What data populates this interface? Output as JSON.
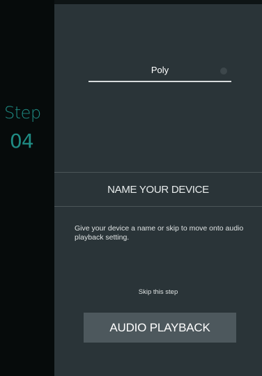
{
  "step": {
    "word": "Step",
    "number": "04"
  },
  "device_name": {
    "value": "Poly"
  },
  "section": {
    "title": "NAME YOUR DEVICE"
  },
  "description": "Give your device a name or skip to move onto audio playback setting.",
  "skip_label": "Skip this step",
  "primary_button_label": "AUDIO PLAYBACK",
  "colors": {
    "accent": "#1f8c84",
    "panel": "#2a3438",
    "background": "#060b0b",
    "button": "#4d585d"
  },
  "icons": {
    "clear": "clear-dot-icon"
  }
}
